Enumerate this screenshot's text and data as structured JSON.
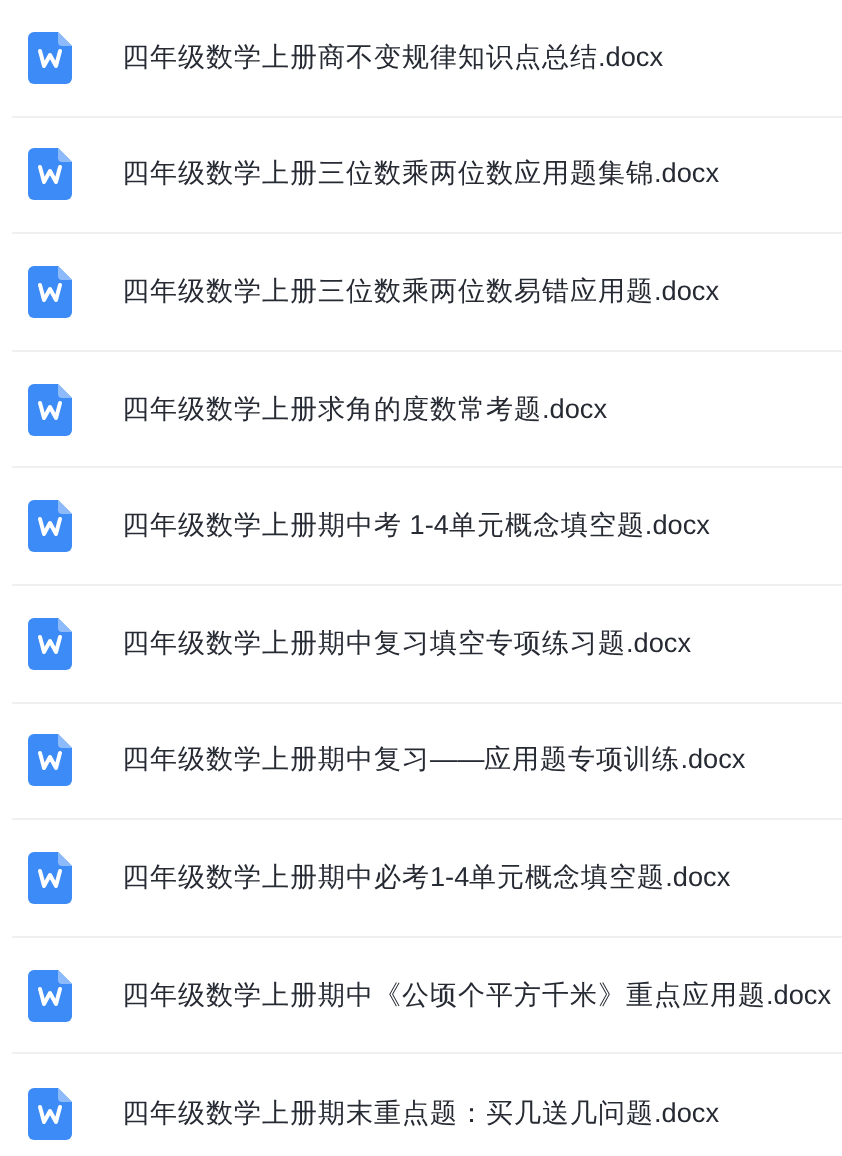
{
  "files": [
    {
      "name": "四年级数学上册商不变规律知识点总结.docx",
      "kind": "word"
    },
    {
      "name": "四年级数学上册三位数乘两位数应用题集锦.docx",
      "kind": "word"
    },
    {
      "name": "四年级数学上册三位数乘两位数易错应用题.docx",
      "kind": "word"
    },
    {
      "name": "四年级数学上册求角的度数常考题.docx",
      "kind": "word"
    },
    {
      "name": "四年级数学上册期中考 1-4单元概念填空题.docx",
      "kind": "word"
    },
    {
      "name": "四年级数学上册期中复习填空专项练习题.docx",
      "kind": "word"
    },
    {
      "name": "四年级数学上册期中复习——应用题专项训练.docx",
      "kind": "word"
    },
    {
      "name": "四年级数学上册期中必考1-4单元概念填空题.docx",
      "kind": "word"
    },
    {
      "name": "四年级数学上册期中《公顷个平方千米》重点应用题.docx",
      "kind": "word"
    },
    {
      "name": "四年级数学上册期末重点题：买几送几问题.docx",
      "kind": "word"
    }
  ]
}
